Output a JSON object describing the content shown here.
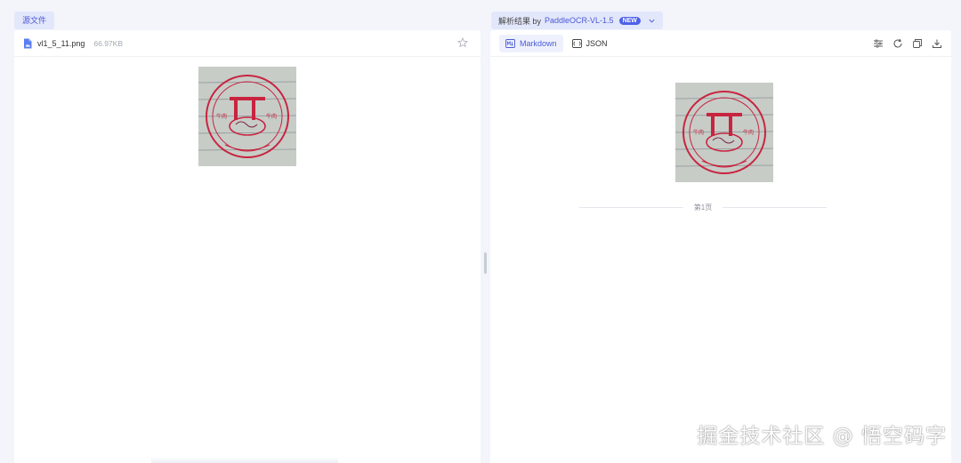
{
  "left_panel": {
    "tag": "源文件",
    "file_name": "vl1_5_11.png",
    "file_size": "66.97KB"
  },
  "right_panel": {
    "tag_prefix": "解析结果 by",
    "model_name": "PaddleOCR-VL-1.5",
    "new_badge": "NEW",
    "tabs": [
      {
        "label": "Markdown",
        "active": true
      },
      {
        "label": "JSON",
        "active": false
      }
    ],
    "page_label": "第1页"
  },
  "watermark": "掘金技术社区 @ 悟空码字",
  "colors": {
    "accent": "#4a5ad6",
    "tag_bg": "#e3e7fb",
    "stamp_red": "#c8243f",
    "page_bg": "#f3f5fb"
  },
  "icons": {
    "file": "image-file-icon",
    "star": "star-icon",
    "markdown": "markdown-icon",
    "json": "json-icon",
    "tools": [
      "settings-sliders-icon",
      "refresh-icon",
      "copy-icon",
      "download-icon"
    ]
  }
}
